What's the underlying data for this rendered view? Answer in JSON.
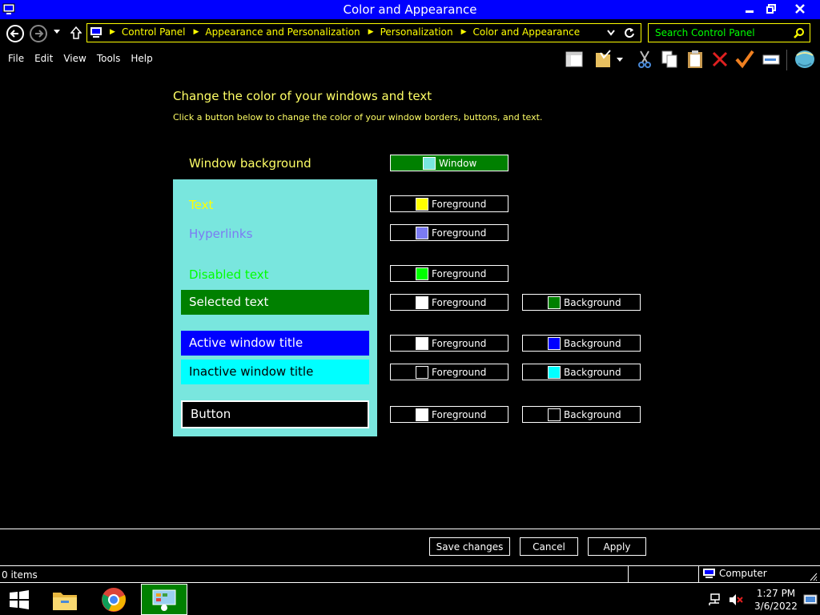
{
  "window": {
    "title": "Color and Appearance"
  },
  "address": {
    "crumbs": [
      "Control Panel",
      "Appearance and Personalization",
      "Personalization",
      "Color and Appearance"
    ]
  },
  "search": {
    "placeholder": "Search Control Panel"
  },
  "menu": {
    "file": "File",
    "edit": "Edit",
    "view": "View",
    "tools": "Tools",
    "help": "Help"
  },
  "page": {
    "heading": "Change the color of your windows and text",
    "subheading": "Click a button below to change the color of your window borders, buttons, and text."
  },
  "preview": {
    "window_background": "Window background",
    "text": "Text",
    "hyperlinks": "Hyperlinks",
    "disabled_text": "Disabled text",
    "selected_text": "Selected text",
    "active_title": "Active window title",
    "inactive_title": "Inactive window title",
    "button": "Button"
  },
  "color_buttons": {
    "window": "Window",
    "foreground": "Foreground",
    "background": "Background"
  },
  "colors": {
    "window": "#79e6de",
    "text": "#ffff00",
    "hyperlinks": "#7b7bf2",
    "disabled": "#00ff00",
    "selected_bg": "#008000",
    "selected_fg": "#ffffff",
    "active_fg": "#ffffff",
    "active_bg": "#0000ff",
    "inactive_fg": "#000000",
    "inactive_bg": "#00ffff",
    "button_fg": "#ffffff",
    "button_bg": "#000000"
  },
  "footer": {
    "save": "Save changes",
    "cancel": "Cancel",
    "apply": "Apply"
  },
  "status": {
    "items": "0 items",
    "location": "Computer"
  },
  "clock": {
    "time": "1:27 PM",
    "date": "3/6/2022"
  }
}
